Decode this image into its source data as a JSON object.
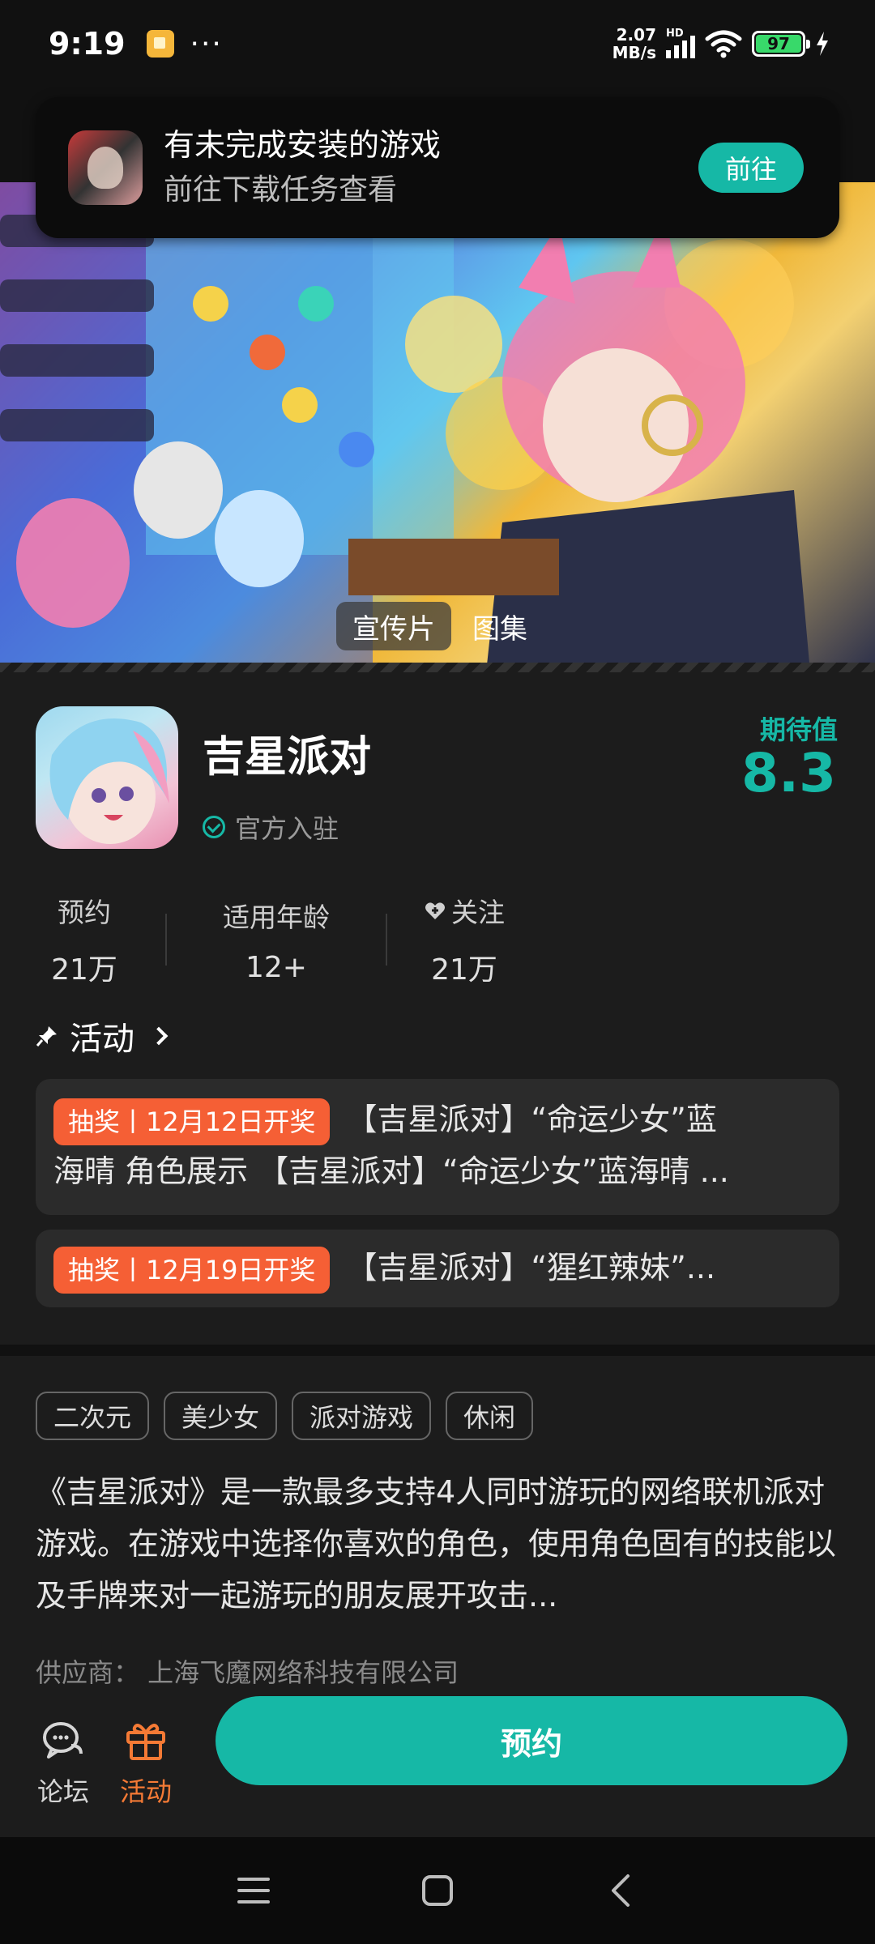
{
  "status_bar": {
    "time": "9:19",
    "more": "···",
    "net_speed_value": "2.07",
    "net_speed_unit": "MB/s",
    "hd_label": "HD",
    "battery": "97"
  },
  "install_notice": {
    "title": "有未完成安装的游戏",
    "subtitle": "前往下载任务查看",
    "button": "前往"
  },
  "media_tabs": [
    {
      "label": "宣传片",
      "active": true
    },
    {
      "label": "图集",
      "active": false
    }
  ],
  "game": {
    "title": "吉星派对",
    "verified_label": "官方入驻",
    "expect_label": "期待值",
    "expect_value": "8.3"
  },
  "stats": [
    {
      "label": "预约",
      "value": "21万"
    },
    {
      "label": "适用年龄",
      "value": "12+"
    },
    {
      "label": "关注",
      "value": "21万",
      "icon": "heart-plus-icon"
    }
  ],
  "activities": {
    "header": "活动",
    "items": [
      {
        "badge": "抽奖丨12月12日开奖",
        "text_first": "【吉星派对】“命运少女”蓝",
        "text_second": "海晴 角色展示 【吉星派对】“命运少女”蓝海晴 ..."
      },
      {
        "badge": "抽奖丨12月19日开奖",
        "text_first": "【吉星派对】“猩红辣妹”..."
      }
    ]
  },
  "tags": [
    "二次元",
    "美少女",
    "派对游戏",
    "休闲"
  ],
  "description": "《吉星派对》是一款最多支持4人同时游玩的网络联机派对游戏。在游戏中选择你喜欢的角色，使用角色固有的技能以及手牌来对一起游玩的朋友展开攻击...",
  "supplier": "供应商：  上海飞魔网络科技有限公司",
  "bottom_bar": {
    "forum_label": "论坛",
    "activity_label": "活动",
    "reserve_button": "预约"
  },
  "colors": {
    "accent": "#16b8a6",
    "lottery_badge": "#f55f35",
    "activity_orange": "#f57a35"
  }
}
